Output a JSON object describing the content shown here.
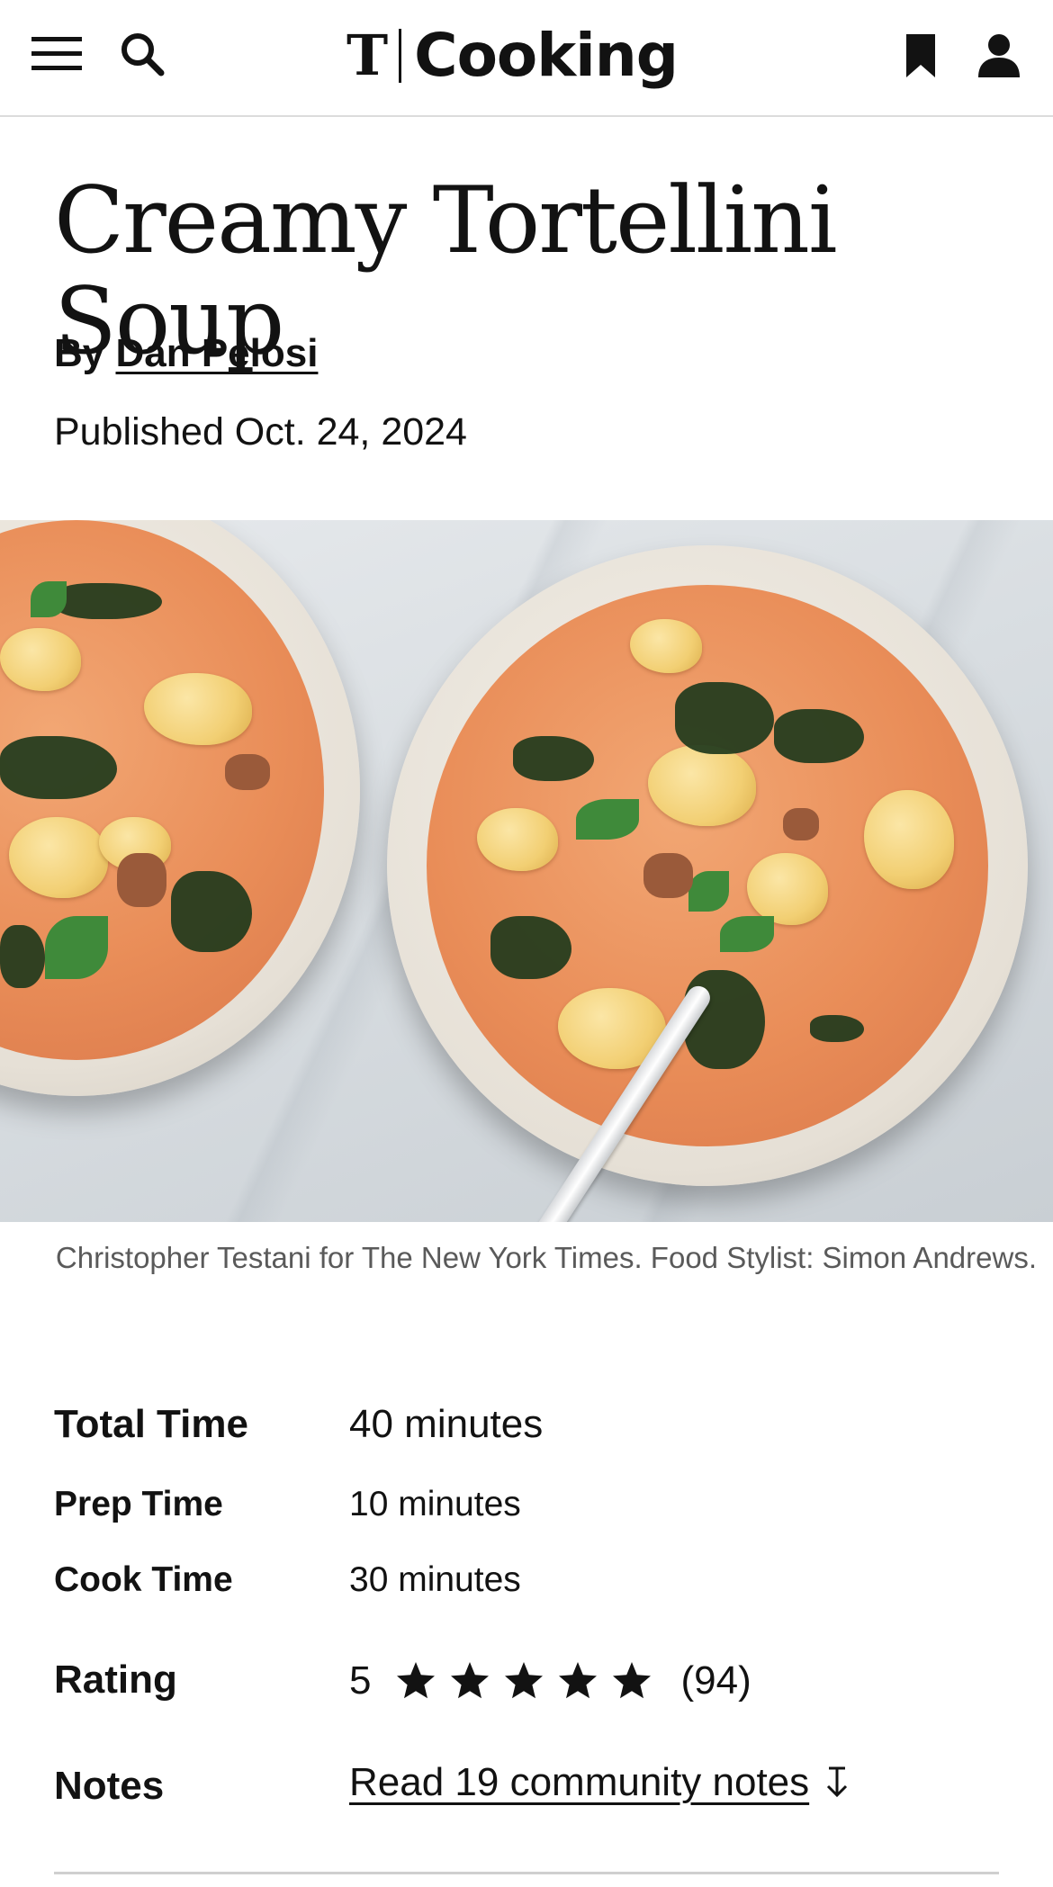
{
  "header": {
    "brand_mark": "T",
    "brand_name": "Cooking",
    "icons": [
      "menu-icon",
      "search-icon",
      "bookmark-icon",
      "account-icon"
    ]
  },
  "recipe": {
    "title": "Creamy Tortellini Soup",
    "byline_prefix": "By",
    "author": "Dan Pelosi",
    "published": "Published Oct. 24, 2024",
    "photo_caption": "Christopher Testani for The New York Times. Food Stylist: Simon Andrews."
  },
  "meta": {
    "total_time_label": "Total Time",
    "total_time_value": "40 minutes",
    "prep_time_label": "Prep Time",
    "prep_time_value": "10 minutes",
    "cook_time_label": "Cook Time",
    "cook_time_value": "30 minutes",
    "rating_label": "Rating",
    "rating_value": "5",
    "rating_stars": 5,
    "rating_count": "(94)",
    "notes_label": "Notes",
    "notes_link": "Read 19 community notes"
  }
}
